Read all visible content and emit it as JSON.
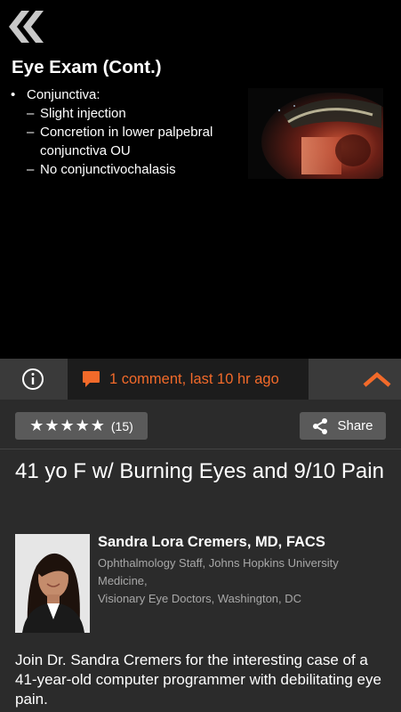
{
  "slide": {
    "title": "Eye Exam (Cont.)",
    "bullet": "Conjunctiva:",
    "bullet_marker": "•",
    "sub_marker": "–",
    "sub_items": [
      "Slight injection",
      "Concretion in lower palpebral conjunctiva OU",
      "No conjunctivochalasis"
    ],
    "back_icon": "double-chevron-left-icon",
    "image": "slit-lamp-eye-photo"
  },
  "toolbar": {
    "info_icon": "info-circle-icon",
    "comment_icon": "speech-bubble-icon",
    "comment_text": "1 comment, last 10 hr ago",
    "collapse_icon": "chevron-up-icon",
    "accent_color": "#f26a2a"
  },
  "rating": {
    "stars": "★★★★★",
    "count": "(15)",
    "value": 5
  },
  "share": {
    "label": "Share",
    "icon": "share-icon"
  },
  "case": {
    "title": "41 yo F w/ Burning Eyes and 9/10 Pain"
  },
  "author": {
    "name": "Sandra Lora Cremers, MD, FACS",
    "affiliation_line1": "Ophthalmology Staff, Johns Hopkins University Medicine,",
    "affiliation_line2": "Visionary Eye Doctors, Washington, DC"
  },
  "description": "Join Dr. Sandra Cremers for the interesting case of a 41-year-old computer programmer with debilitating eye pain."
}
